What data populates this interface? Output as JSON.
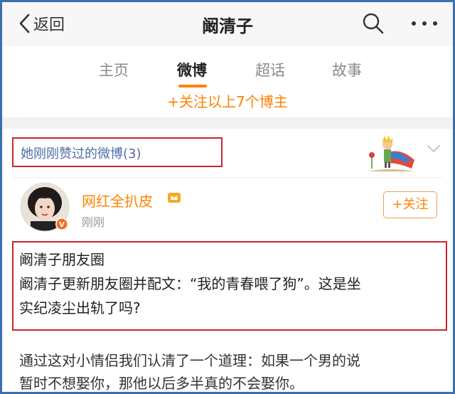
{
  "navbar": {
    "back_label": "返回",
    "title": "阚清子",
    "icons": [
      "back-chevron-icon",
      "search-icon",
      "more-icon"
    ]
  },
  "tabs": [
    {
      "label": "主页",
      "active": false
    },
    {
      "label": "微博",
      "active": true
    },
    {
      "label": "超话",
      "active": false
    },
    {
      "label": "故事",
      "active": false
    }
  ],
  "follow_all_label": "+关注以上7个博主",
  "liked": {
    "label": "她刚刚赞过的微博(3)"
  },
  "post": {
    "author": "网红全扒皮",
    "time": "刚刚",
    "follow_label": "+关注",
    "highlight_lines": [
      "阚清子朋友圈",
      "阚清子更新朋友圈并配文：“我的青春喂了狗”。这是坐",
      "实纪凌尘出轨了吗?"
    ],
    "body_lines": [
      "通过这对小情侣我们认清了一个道理：如果一个男的说",
      "暂时不想娶你，那他以后多半真的不会娶你。"
    ]
  },
  "colors": {
    "accent": "#ff8200",
    "link": "#4e6ea6",
    "highlight_border": "#c8262f",
    "frame_border": "#3a6fb0"
  }
}
